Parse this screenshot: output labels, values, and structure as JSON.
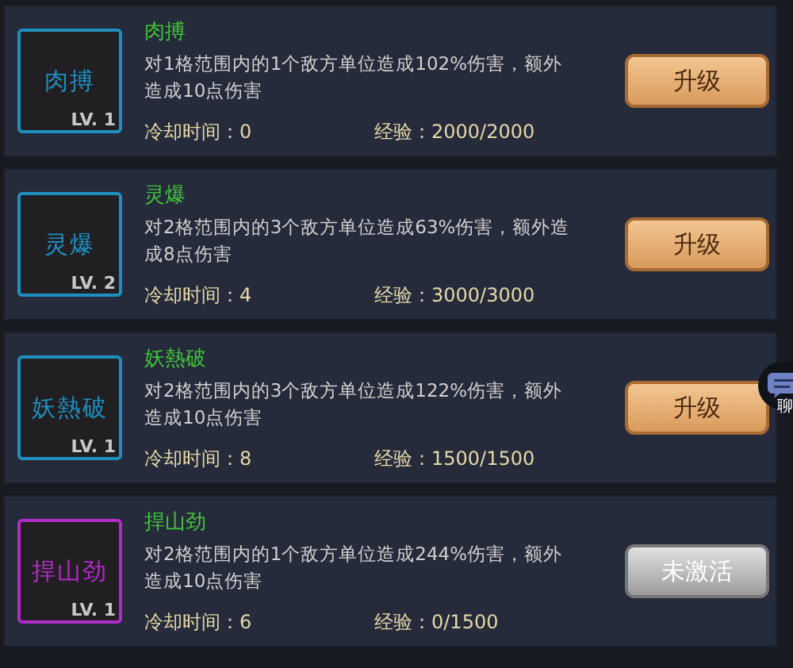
{
  "skills": [
    {
      "icon_label": "肉搏",
      "level": "LV. 1",
      "color": "#1e8fc0",
      "name": "肉搏",
      "description": "对1格范围内的1个敌方单位造成102%伤害，额外造成10点伤害",
      "cooldown_label": "冷却时间：",
      "cooldown": "0",
      "exp_label": "经验：",
      "exp": "2000/2000",
      "button": "升级",
      "active": true
    },
    {
      "icon_label": "灵爆",
      "level": "LV. 2",
      "color": "#1e8fc0",
      "name": "灵爆",
      "description": "对2格范围内的3个敌方单位造成63%伤害，额外造成8点伤害",
      "cooldown_label": "冷却时间：",
      "cooldown": "4",
      "exp_label": "经验：",
      "exp": "3000/3000",
      "button": "升级",
      "active": true
    },
    {
      "icon_label": "妖熱破",
      "level": "LV. 1",
      "color": "#1e8fc0",
      "name": "妖熱破",
      "description": "对2格范围内的3个敌方单位造成122%伤害，额外造成10点伤害",
      "cooldown_label": "冷却时间：",
      "cooldown": "8",
      "exp_label": "经验：",
      "exp": "1500/1500",
      "button": "升级",
      "active": true
    },
    {
      "icon_label": "捍山劲",
      "level": "LV. 1",
      "color": "#b02cc8",
      "name": "捍山劲",
      "description": "对2格范围内的1个敌方单位造成244%伤害，额外造成10点伤害",
      "cooldown_label": "冷却时间：",
      "cooldown": "6",
      "exp_label": "经验：",
      "exp": "0/1500",
      "button": "未激活",
      "active": false
    }
  ],
  "chat": {
    "label": "聊"
  }
}
